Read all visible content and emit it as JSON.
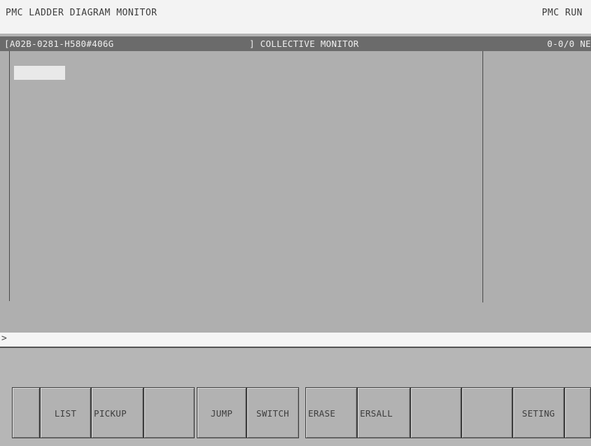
{
  "top": {
    "title": "PMC LADDER DIAGRAM MONITOR",
    "status": "PMC RUN"
  },
  "header": {
    "left": "[A02B-0281-H580#406G",
    "center": "] COLLECTIVE MONITOR",
    "right": "0-0/0 NE"
  },
  "input": {
    "prompt": ">"
  },
  "softkeys": [
    {
      "label": ""
    },
    {
      "label": "LIST"
    },
    {
      "label": "PICKUP"
    },
    {
      "label": ""
    },
    {
      "label": "JUMP"
    },
    {
      "label": "SWITCH"
    },
    {
      "label": "ERASE"
    },
    {
      "label": "ERSALL"
    },
    {
      "label": ""
    },
    {
      "label": ""
    },
    {
      "label": "SETING"
    },
    {
      "label": ""
    }
  ]
}
